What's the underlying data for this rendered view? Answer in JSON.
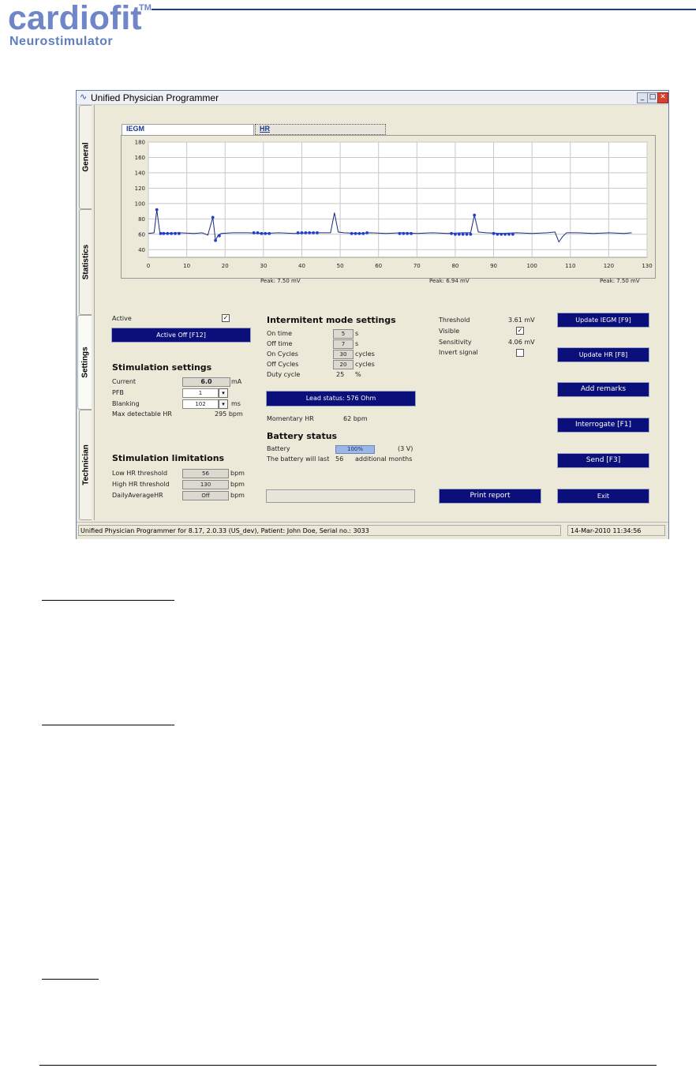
{
  "logo": {
    "main": "cardiofit",
    "tm": "TM",
    "sub": "Neurostimulator"
  },
  "window": {
    "title": "Unified Physician Programmer"
  },
  "side_tabs": [
    "General",
    "Statistics",
    "Settings",
    "Technician"
  ],
  "chart_tabs": [
    "IEGM",
    "HR"
  ],
  "chart_data": {
    "type": "line",
    "x_ticks": [
      0,
      10,
      20,
      30,
      40,
      50,
      60,
      70,
      80,
      90,
      100,
      110,
      120,
      130
    ],
    "y_ticks": [
      40,
      60,
      80,
      100,
      120,
      140,
      160,
      180
    ],
    "xlim": [
      0,
      130
    ],
    "ylim": [
      30,
      180
    ],
    "grid": true,
    "series_trace": [
      [
        0,
        61
      ],
      [
        1.5,
        62
      ],
      [
        2.2,
        92
      ],
      [
        3,
        62
      ],
      [
        5,
        61
      ],
      [
        8,
        62
      ],
      [
        12,
        61
      ],
      [
        14,
        62
      ],
      [
        15.5,
        59
      ],
      [
        16.8,
        82
      ],
      [
        17.5,
        52
      ],
      [
        18.2,
        59
      ],
      [
        19,
        61
      ],
      [
        22,
        62
      ],
      [
        26,
        62
      ],
      [
        30,
        61
      ],
      [
        34,
        62
      ],
      [
        38,
        61
      ],
      [
        42,
        62
      ],
      [
        46,
        62
      ],
      [
        47.5,
        62
      ],
      [
        48.5,
        88
      ],
      [
        49.5,
        63
      ],
      [
        51,
        62
      ],
      [
        55,
        61
      ],
      [
        58,
        62
      ],
      [
        62,
        61
      ],
      [
        66,
        62
      ],
      [
        70,
        61
      ],
      [
        74,
        62
      ],
      [
        78,
        61
      ],
      [
        82,
        62
      ],
      [
        84,
        62
      ],
      [
        85,
        85
      ],
      [
        86,
        63
      ],
      [
        88,
        62
      ],
      [
        92,
        61
      ],
      [
        96,
        62
      ],
      [
        100,
        61
      ],
      [
        104,
        62
      ],
      [
        106,
        63
      ],
      [
        107,
        50
      ],
      [
        108,
        57
      ],
      [
        109,
        62
      ],
      [
        112,
        62
      ],
      [
        116,
        61
      ],
      [
        120,
        62
      ],
      [
        124,
        61
      ],
      [
        126,
        62
      ]
    ],
    "series_markers": [
      [
        2.2,
        92
      ],
      [
        3.2,
        61
      ],
      [
        4,
        61
      ],
      [
        5,
        61
      ],
      [
        6,
        61
      ],
      [
        7,
        61
      ],
      [
        8,
        61
      ],
      [
        16.8,
        82
      ],
      [
        17.5,
        52
      ],
      [
        18.5,
        58
      ],
      [
        27.5,
        62
      ],
      [
        28.5,
        62
      ],
      [
        29.5,
        61
      ],
      [
        30.5,
        61
      ],
      [
        31.5,
        61
      ],
      [
        39,
        62
      ],
      [
        40,
        62
      ],
      [
        41,
        62
      ],
      [
        42,
        62
      ],
      [
        43,
        62
      ],
      [
        44,
        62
      ],
      [
        53,
        61
      ],
      [
        54,
        61
      ],
      [
        55,
        61
      ],
      [
        56,
        61
      ],
      [
        57,
        62
      ],
      [
        65.5,
        61
      ],
      [
        66.5,
        61
      ],
      [
        67.5,
        61
      ],
      [
        68.5,
        61
      ],
      [
        79,
        61
      ],
      [
        80,
        60
      ],
      [
        81,
        60
      ],
      [
        82,
        60
      ],
      [
        83,
        60
      ],
      [
        84,
        60
      ],
      [
        85,
        85
      ],
      [
        90,
        61
      ],
      [
        91,
        60
      ],
      [
        92,
        60
      ],
      [
        93,
        60
      ],
      [
        94,
        60
      ],
      [
        95,
        60
      ]
    ],
    "peaks": [
      "Peak:   7.50 mV",
      "Peak:    6.94 mV",
      "Peak:    7.50 mV"
    ]
  },
  "stim_active": {
    "label": "Active",
    "checked": "✓",
    "button": "Active Off  [F12]"
  },
  "stimulation_settings": {
    "title": "Stimulation settings",
    "current_label": "Current",
    "current_value": "6.0",
    "current_unit": "mA",
    "pfb_label": "PFB",
    "pfb_value": "1",
    "blanking_label": "Blanking",
    "blanking_value": "102",
    "blanking_unit": "ms",
    "maxhr_label": "Max detectable HR",
    "maxhr_value": "295 bpm"
  },
  "stimulation_limitations": {
    "title": "Stimulation limitations",
    "low_label": "Low HR threshold",
    "low_value": "56",
    "low_unit": "bpm",
    "high_label": "High HR threshold",
    "high_value": "130",
    "high_unit": "bpm",
    "daily_label": "DailyAverageHR",
    "daily_value": "Off",
    "daily_unit": "bpm"
  },
  "intermittent": {
    "title": "Intermitent mode settings",
    "on_time_label": "On time",
    "on_time_value": "5",
    "on_time_unit": "s",
    "off_time_label": "Off time",
    "off_time_value": "7",
    "off_time_unit": "s",
    "on_cycles_label": "On Cycles",
    "on_cycles_value": "30",
    "on_cycles_unit": "cycles",
    "off_cycles_label": "Off Cycles",
    "off_cycles_value": "20",
    "off_cycles_unit": "cycles",
    "duty_label": "Duty cycle",
    "duty_value": "25",
    "duty_unit": "%"
  },
  "lead_status": "Lead status:  576 Ohm",
  "momentary_hr": {
    "label": "Momentary HR",
    "value": "62 bpm"
  },
  "battery": {
    "title": "Battery status",
    "label": "Battery",
    "level": 1.0,
    "percent": "100%",
    "volts": "(3 V)",
    "last_prefix": "The battery will last",
    "months": "56",
    "last_suffix": "additional months"
  },
  "sensing": {
    "threshold_label": "Threshold",
    "threshold_value": "3.61 mV",
    "visible_label": "Visible",
    "visible_checked": "✓",
    "sensitivity_label": "Sensitivity",
    "sensitivity_value": "4.06 mV",
    "invert_label": "Invert signal"
  },
  "buttons": {
    "update_iegm": "Update IEGM [F9]",
    "update_hr": "Update HR [F8]",
    "add_remarks": "Add remarks",
    "interrogate": "Interrogate  [F1]",
    "send": "Send  [F3]",
    "print": "Print report",
    "exit": "Exit"
  },
  "statusbar": {
    "left": "Unified Physician Programmer for 8.17,  2.0.33  (US_dev),  Patient: John Doe, Serial no.: 3033",
    "right": "14-Mar-2010 11:34:56"
  }
}
